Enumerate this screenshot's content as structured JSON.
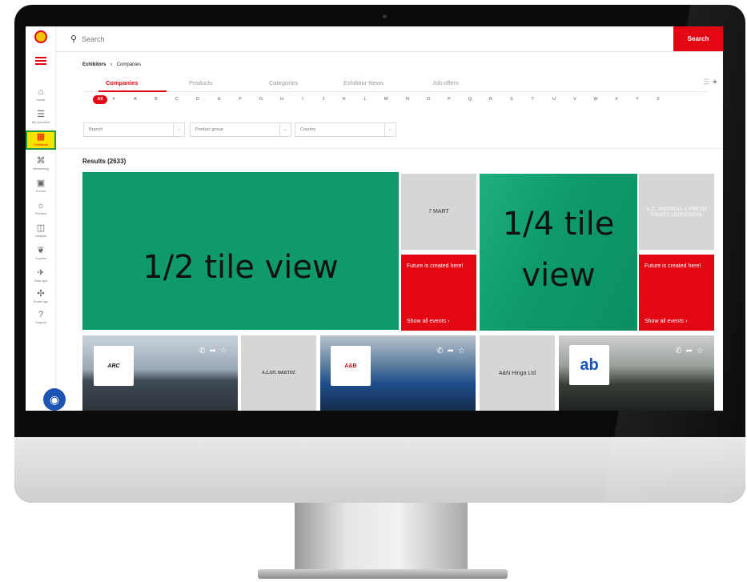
{
  "search": {
    "placeholder": "Search",
    "button": "Search"
  },
  "sidebar": {
    "items": [
      {
        "label": "Home",
        "icon": "home-icon",
        "glyph": "⌂"
      },
      {
        "label": "My schedule",
        "icon": "schedule-icon",
        "glyph": "☰"
      },
      {
        "label": "Exhibitors",
        "icon": "exhibitors-icon",
        "glyph": "▦"
      },
      {
        "label": "Networking",
        "icon": "networking-icon",
        "glyph": "⌘"
      },
      {
        "label": "Events",
        "icon": "events-icon",
        "glyph": "▣"
      },
      {
        "label": "Preview",
        "icon": "preview-icon",
        "glyph": "☼"
      },
      {
        "label": "Hallplan",
        "icon": "hallplan-icon",
        "glyph": "◫"
      },
      {
        "label": "Organic",
        "icon": "organic-icon",
        "glyph": "❦"
      },
      {
        "label": "Start-ups",
        "icon": "startups-icon",
        "glyph": "✈"
      },
      {
        "label": "Smart Agri",
        "icon": "smart-agri-icon",
        "glyph": "✣"
      },
      {
        "label": "Support",
        "icon": "support-icon",
        "glyph": "?"
      }
    ]
  },
  "breadcrumb": {
    "root": "Exhibitors",
    "current": "Companies"
  },
  "tabs": [
    "Companies",
    "Products",
    "Categories",
    "Exhibitor News",
    "Job offers"
  ],
  "alphabet": [
    "All",
    "#",
    "A",
    "B",
    "C",
    "D",
    "E",
    "F",
    "G",
    "H",
    "I",
    "J",
    "K",
    "L",
    "M",
    "N",
    "O",
    "P",
    "Q",
    "R",
    "S",
    "T",
    "U",
    "V",
    "W",
    "X",
    "Y",
    "Z"
  ],
  "filters": [
    "Branch",
    "Product group",
    "Country"
  ],
  "results": "Results (2633)",
  "tiles": {
    "half_label": "1/2 tile view",
    "quarter_label_1": "1/4 tile",
    "quarter_label_2": "view",
    "grey1": "7 MART",
    "grey2": "A.C. ANIDROU -L FRESH FRUITS LEONTIADIS",
    "red_text": "Future is created here!",
    "red_link": "Show all events  ›",
    "arc": "ARC",
    "faistos": "Α.Σ.ΟΠ. ΦΑΙΣΤΟΣ",
    "ab_logo": "A&B",
    "hinga": "A&N Hinga Ltd",
    "ab2": "ab"
  },
  "colors": {
    "accent": "#e30613",
    "green": "#0e9a6a",
    "highlight": "#f8e200"
  }
}
